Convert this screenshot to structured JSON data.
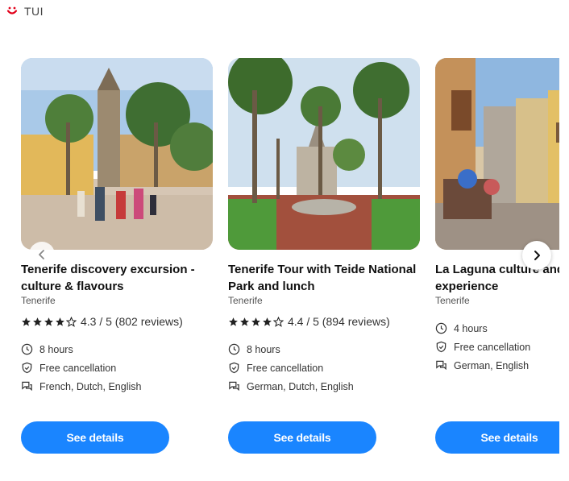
{
  "brand": {
    "name": "TUI",
    "logo_color": "#e2001a"
  },
  "cards": [
    {
      "title": "Tenerife discovery excursion - culture & flavours",
      "location": "Tenerife",
      "rating_text": "4.3 / 5 (802 reviews)",
      "rating": 4.3,
      "duration": "8 hours",
      "cancellation": "Free cancellation",
      "languages": "French, Dutch, English",
      "button": "See details"
    },
    {
      "title": "Tenerife Tour with Teide National Park and lunch",
      "location": "Tenerife",
      "rating_text": "4.4 / 5 (894 reviews)",
      "rating": 4.4,
      "duration": "8 hours",
      "cancellation": "Free cancellation",
      "languages": "German, Dutch, English",
      "button": "See details"
    },
    {
      "title": "La Laguna culture and wine experience",
      "location": "Tenerife",
      "duration": "4 hours",
      "cancellation": "Free cancellation",
      "languages": "German, English",
      "button": "See details"
    }
  ],
  "colors": {
    "button": "#1a85ff",
    "star": "#222222"
  },
  "icons": {
    "prev": "chevron-left-icon",
    "next": "chevron-right-icon"
  }
}
